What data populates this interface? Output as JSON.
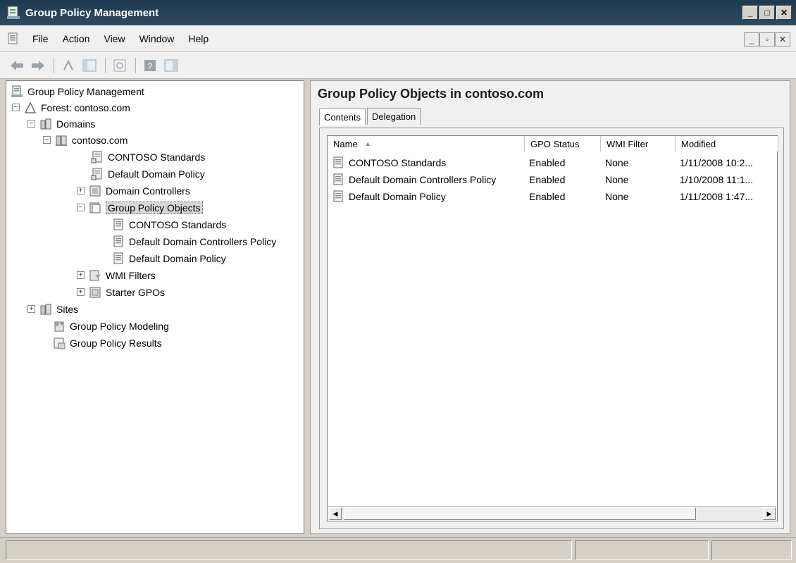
{
  "window": {
    "title": "Group Policy Management"
  },
  "menu": {
    "items": [
      "File",
      "Action",
      "View",
      "Window",
      "Help"
    ]
  },
  "tree": {
    "root": "Group Policy Management",
    "forest": "Forest: contoso.com",
    "domains": "Domains",
    "domain": "contoso.com",
    "contoso_standards": "CONTOSO Standards",
    "default_domain_policy": "Default Domain Policy",
    "domain_controllers": "Domain Controllers",
    "group_policy_objects": "Group Policy Objects",
    "gpo_contoso_standards": "CONTOSO Standards",
    "gpo_default_dc_policy": "Default Domain Controllers Policy",
    "gpo_default_domain_policy": "Default Domain Policy",
    "wmi_filters": "WMI Filters",
    "starter_gpos": "Starter GPOs",
    "sites": "Sites",
    "modeling": "Group Policy Modeling",
    "results": "Group Policy Results"
  },
  "main": {
    "title": "Group Policy Objects in contoso.com",
    "tabs": [
      "Contents",
      "Delegation"
    ],
    "columns": [
      "Name",
      "GPO Status",
      "WMI Filter",
      "Modified"
    ],
    "rows": [
      {
        "name": "CONTOSO Standards",
        "status": "Enabled",
        "wmi": "None",
        "modified": "1/11/2008 10:2..."
      },
      {
        "name": "Default Domain Controllers Policy",
        "status": "Enabled",
        "wmi": "None",
        "modified": "1/10/2008 11:1..."
      },
      {
        "name": "Default Domain Policy",
        "status": "Enabled",
        "wmi": "None",
        "modified": "1/11/2008 1:47..."
      }
    ]
  }
}
